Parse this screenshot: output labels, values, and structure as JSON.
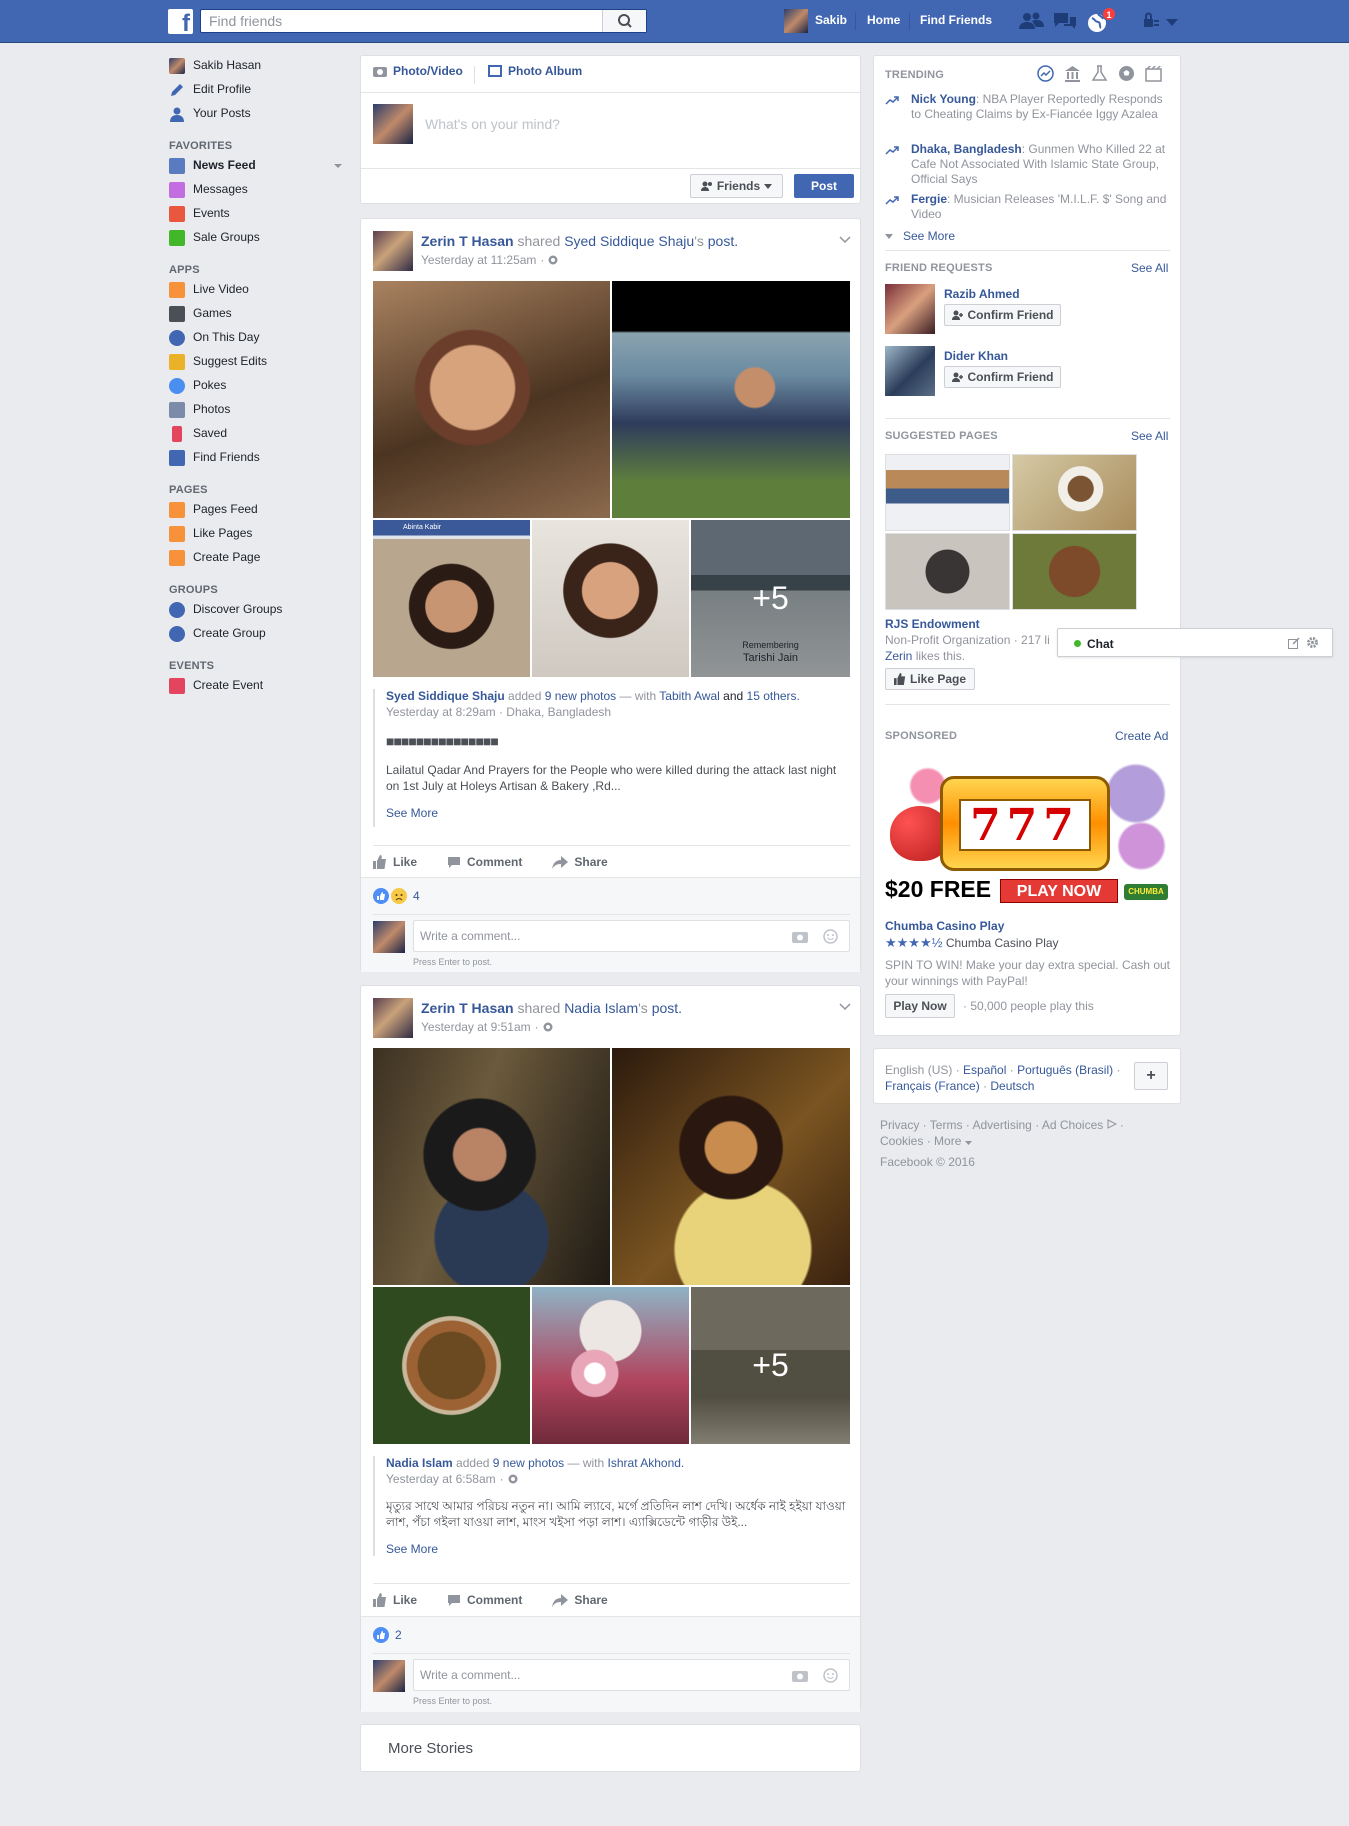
{
  "topbar": {
    "logo": "f",
    "search_placeholder": "Find friends",
    "user_name": "Sakib",
    "home": "Home",
    "find_friends": "Find Friends",
    "notification_count": "1"
  },
  "leftnav": {
    "profile": [
      {
        "label": "Sakib Hasan",
        "icon": "avatar",
        "color": "#3b5998"
      },
      {
        "label": "Edit Profile",
        "icon": "pencil-icon",
        "color": "#4267b2"
      },
      {
        "label": "Your Posts",
        "icon": "user-icon",
        "color": "#4267b2"
      }
    ],
    "favorites_heading": "FAVORITES",
    "favorites": [
      {
        "label": "News Feed",
        "icon": "news-feed-icon",
        "color": "#5b7bc0"
      },
      {
        "label": "Messages",
        "icon": "messages-icon",
        "color": "#c26de0"
      },
      {
        "label": "Events",
        "icon": "events-icon",
        "color": "#e9573f"
      },
      {
        "label": "Sale Groups",
        "icon": "sale-groups-icon",
        "color": "#42b72a"
      }
    ],
    "apps_heading": "APPS",
    "apps": [
      {
        "label": "Live Video",
        "icon": "live-video-icon",
        "color": "#f7923a"
      },
      {
        "label": "Games",
        "icon": "games-icon",
        "color": "#4b4f56"
      },
      {
        "label": "On This Day",
        "icon": "on-this-day-icon",
        "color": "#4267b2"
      },
      {
        "label": "Suggest Edits",
        "icon": "suggest-edits-icon",
        "color": "#e9b229"
      },
      {
        "label": "Pokes",
        "icon": "pokes-icon",
        "color": "#4a8ef0"
      },
      {
        "label": "Photos",
        "icon": "photos-icon",
        "color": "#7b8ba9"
      },
      {
        "label": "Saved",
        "icon": "saved-icon",
        "color": "#e3455e"
      },
      {
        "label": "Find Friends",
        "icon": "find-friends-icon",
        "color": "#4267b2"
      }
    ],
    "pages_heading": "PAGES",
    "pages": [
      {
        "label": "Pages Feed",
        "icon": "pages-feed-icon",
        "color": "#f7923a"
      },
      {
        "label": "Like Pages",
        "icon": "like-pages-icon",
        "color": "#f7923a"
      },
      {
        "label": "Create Page",
        "icon": "create-page-icon",
        "color": "#f7923a"
      }
    ],
    "groups_heading": "GROUPS",
    "groups": [
      {
        "label": "Discover Groups",
        "icon": "discover-groups-icon",
        "color": "#4267b2"
      },
      {
        "label": "Create Group",
        "icon": "create-group-icon",
        "color": "#4267b2"
      }
    ],
    "events_heading": "EVENTS",
    "events": [
      {
        "label": "Create Event",
        "icon": "create-event-icon",
        "color": "#e3455e"
      }
    ]
  },
  "composer": {
    "photo_video": "Photo/Video",
    "photo_album": "Photo Album",
    "placeholder": "What's on your mind?",
    "audience": "Friends",
    "post": "Post"
  },
  "post1": {
    "author": "Zerin T Hasan",
    "shared": "shared",
    "source": "Syed Siddique Shaju",
    "possessive": "'s",
    "post_word": "post.",
    "time": "Yesterday at 11:25am",
    "plus_more": "+5",
    "overlay_caption_1": "Remembering",
    "overlay_caption_2": "Tarishi Jain",
    "screenshot_name": "Abinta Kabir",
    "inner_author": "Syed Siddique Shaju",
    "inner_added": "added",
    "inner_photos": "9 new photos",
    "inner_with": "— with",
    "inner_tag1": "Tabith Awal",
    "inner_and": "and",
    "inner_tag2": "15 others.",
    "inner_time": "Yesterday at 8:29am · Dhaka, Bangladesh",
    "inner_boxes": "■■■■■■■■■■■■■■■",
    "inner_text": "Lailatul Qadar And Prayers for the People who were killed during the attack last night on 1st July at Holeys Artisan & Bakery ,Rd...",
    "see_more": "See More",
    "like": "Like",
    "comment": "Comment",
    "share": "Share",
    "reaction_count": "4",
    "comment_placeholder": "Write a comment...",
    "press_enter": "Press Enter to post."
  },
  "post2": {
    "author": "Zerin T Hasan",
    "shared": "shared",
    "source": "Nadia Islam",
    "possessive": "'s",
    "post_word": "post.",
    "time": "Yesterday at 9:51am",
    "plus_more": "+5",
    "inner_author": "Nadia Islam",
    "inner_added": "added",
    "inner_photos": "9 new photos",
    "inner_with": "— with",
    "inner_tag1": "Ishrat Akhond.",
    "inner_time": "Yesterday at 6:58am",
    "inner_text": "মৃত্যুর সাথে আমার পরিচয় নতুন না। আমি ল্যাবে, মর্গে প্রতিদিন লাশ দেখি। অর্ধেক নাই হইয়া যাওয়া লাশ, পঁচা গইলা যাওয়া লাশ, মাংস খইসা পড়া লাশ। এ্যাক্সিডেন্টে গাড়ীর উই...",
    "see_more": "See More",
    "like": "Like",
    "comment": "Comment",
    "share": "Share",
    "reaction_count": "2",
    "comment_placeholder": "Write a comment...",
    "press_enter": "Press Enter to post."
  },
  "more_stories": "More Stories",
  "trending": {
    "heading": "TRENDING",
    "items": [
      {
        "name": "Nick Young",
        "text": ": NBA Player Reportedly Responds to Cheating Claims by Ex-Fiancée Iggy Azalea"
      },
      {
        "name": "Dhaka, Bangladesh",
        "text": ": Gunmen Who Killed 22 at Cafe Not Associated With Islamic State Group, Official Says"
      },
      {
        "name": "Fergie",
        "text": ": Musician Releases 'M.I.L.F. $' Song and Video"
      }
    ],
    "see_more": "See More"
  },
  "friend_requests": {
    "heading": "FRIEND REQUESTS",
    "see_all": "See All",
    "items": [
      {
        "name": "Razib Ahmed",
        "button": "Confirm Friend"
      },
      {
        "name": "Dider Khan",
        "button": "Confirm Friend"
      }
    ]
  },
  "suggested_pages": {
    "heading": "SUGGESTED PAGES",
    "see_all": "See All",
    "page_name": "RJS Endowment",
    "page_meta": "Non-Profit Organization · 217 li",
    "liker": "Zerin",
    "likes_this": "likes this.",
    "like_page": "Like Page"
  },
  "chat": {
    "label": "Chat",
    "status_color": "#42b72a"
  },
  "sponsored": {
    "heading": "SPONSORED",
    "create_ad": "Create Ad",
    "ad_reels": "777",
    "ad_free": "$20 FREE",
    "ad_play": "PLAY NOW",
    "ad_brand": "CHUMBA",
    "title": "Chumba Casino Play",
    "stars": "★★★★½",
    "stars_label": "Chumba Casino Play",
    "desc": "SPIN TO WIN! Make your day extra special. Cash out your winnings with PayPal!",
    "button": "Play Now",
    "social": "· 50,000 people play this"
  },
  "languages": {
    "current": "English (US)",
    "others": [
      "Español",
      "Português (Brasil)",
      "Français (France)",
      "Deutsch"
    ],
    "add": "+"
  },
  "footer": {
    "links": [
      "Privacy",
      "Terms",
      "Advertising",
      "Ad Choices",
      "Cookies",
      "More"
    ],
    "copyright": "Facebook © 2016"
  },
  "colors": {
    "brand_blue": "#4267b2",
    "link_blue": "#365899",
    "notification_red": "#fa3e3e"
  }
}
